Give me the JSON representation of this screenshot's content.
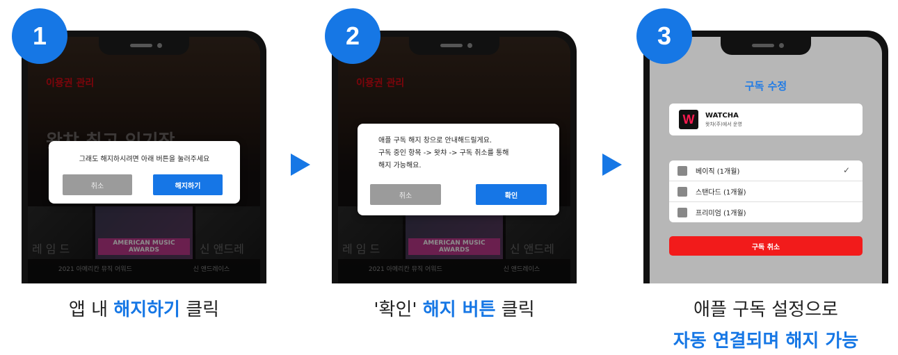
{
  "steps": [
    {
      "number": "1",
      "screen": {
        "menu_title": "이용권 관리",
        "banner_text": "왓챠 최고 인기작",
        "dialog_message": "그래도 해지하시려면 아래 버튼을 눌러주세요",
        "cancel_label": "취소",
        "confirm_label": "해지하기",
        "thumb_caption": "AMERICAN MUSIC AWARDS",
        "thumb_left_text": "레 임 드",
        "thumb_right_text": "신 앤드레",
        "sub_caption_1": "2021 아메리칸 뮤직 어워드",
        "sub_caption_2": "신 앤드레이스"
      },
      "caption": {
        "pre": "앱 내 ",
        "highlight": "해지하기",
        "post": " 클릭"
      }
    },
    {
      "number": "2",
      "screen": {
        "menu_title": "이용권 관리",
        "dialog_line1": "애플 구독 해지 창으로 안내해드릴게요.",
        "dialog_line2": "구독 중인 항목 -> 왓챠 -> 구독 취소를 통해",
        "dialog_line3": "해지 가능해요.",
        "cancel_label": "취소",
        "confirm_label": "확인",
        "thumb_caption": "AMERICAN MUSIC AWARDS",
        "thumb_left_text": "레 임 드",
        "thumb_right_text": "신 앤드레",
        "sub_caption_1": "2021 아메리칸 뮤직 어워드",
        "sub_caption_2": "신 앤드레이스"
      },
      "caption": {
        "pre": "'확인' ",
        "highlight": "해지 버튼",
        "post": " 클릭"
      }
    },
    {
      "number": "3",
      "screen": {
        "title": "구독 수정",
        "app_logo": "W",
        "app_name": "WATCHA",
        "app_dev": "왓챠(주)에서 운영",
        "plans": [
          "베이직 (1개월)",
          "스탠다드 (1개월)",
          "프리미엄 (1개월)"
        ],
        "check": "✓",
        "cancel_label": "구독 취소"
      },
      "caption": {
        "line1": "애플 구독 설정으로",
        "line2": "자동 연결되며 해지 가능"
      }
    }
  ],
  "colors": {
    "accent": "#1677e5",
    "danger": "#f21b1b",
    "brand_red": "#e50914"
  }
}
